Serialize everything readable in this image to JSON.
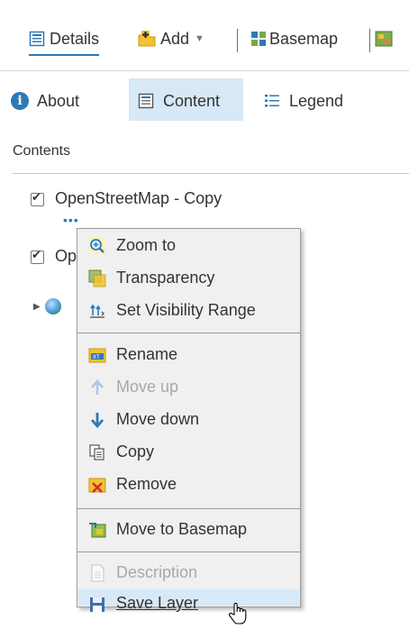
{
  "toolbar": {
    "details": "Details",
    "add": "Add",
    "basemap": "Basemap"
  },
  "tabs": {
    "about": "About",
    "content": "Content",
    "legend": "Legend"
  },
  "contents_heading": "Contents",
  "layers": [
    {
      "label": "OpenStreetMap - Copy",
      "checked": true
    },
    {
      "label": "Op",
      "checked": true
    },
    {
      "label": "",
      "checked": false
    }
  ],
  "menu": {
    "zoom_to": "Zoom to",
    "transparency": "Transparency",
    "set_visibility_range": "Set Visibility Range",
    "rename": "Rename",
    "move_up": "Move up",
    "move_down": "Move down",
    "copy": "Copy",
    "remove": "Remove",
    "move_to_basemap": "Move to Basemap",
    "description": "Description",
    "save_layer": "Save Layer"
  },
  "colors": {
    "accent": "#2e78b8",
    "selected_bg": "#d7e8f7",
    "menu_bg": "#f0f0f0"
  }
}
